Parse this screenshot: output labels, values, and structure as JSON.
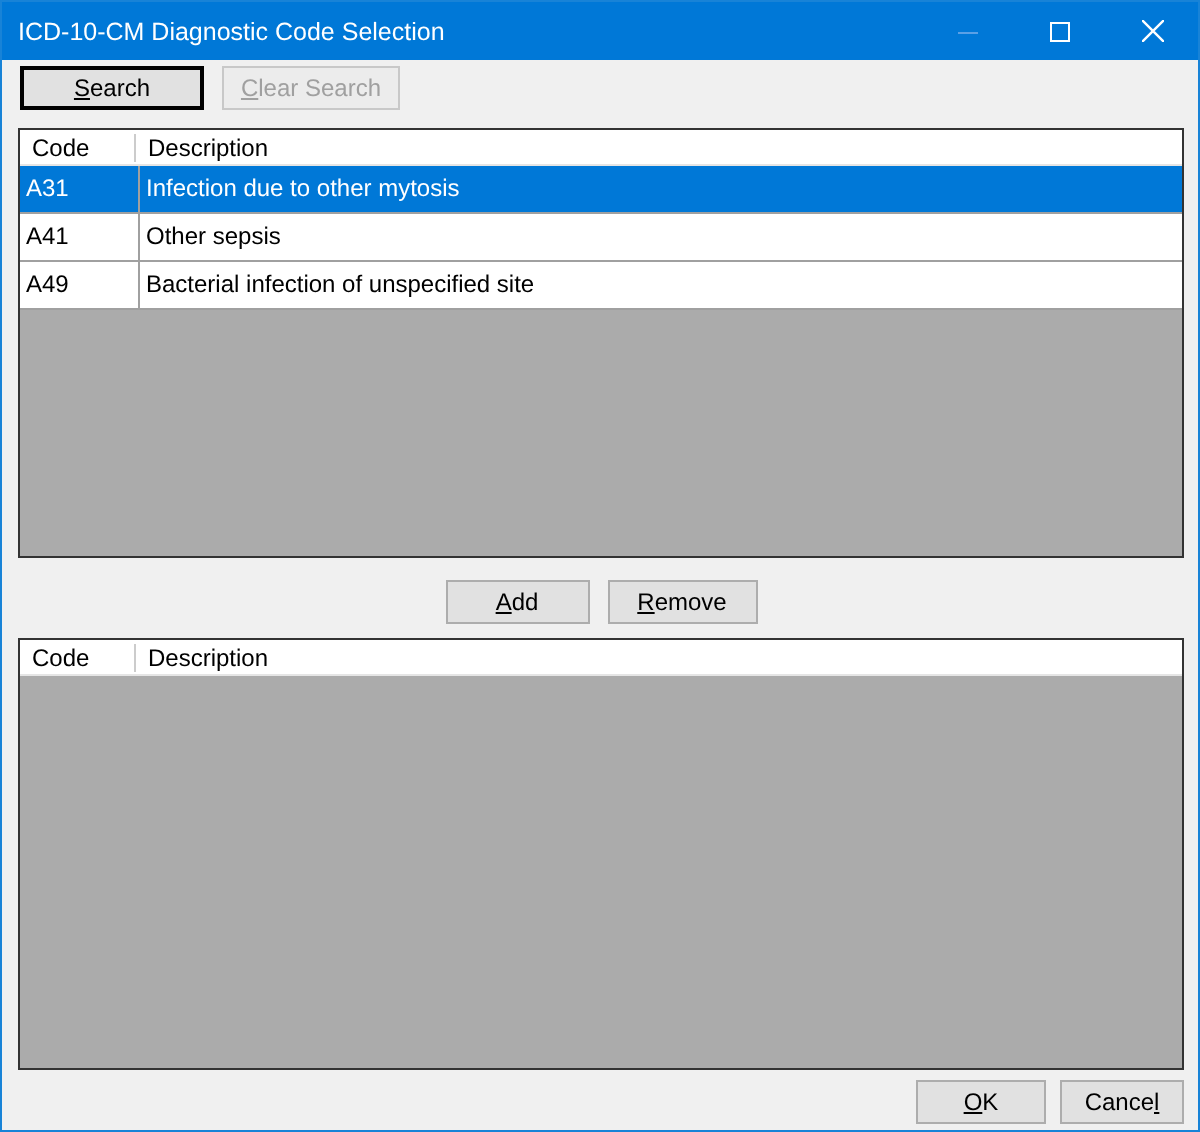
{
  "window": {
    "title": "ICD-10-CM Diagnostic Code Selection"
  },
  "search_buttons": [
    {
      "access_key": "S",
      "after": "earch",
      "disabled": false,
      "default": true
    },
    {
      "access_key": "C",
      "after": "lear Search",
      "disabled": true,
      "default": false
    }
  ],
  "available_codes": {
    "columns": [
      "Code",
      "Description"
    ],
    "rows": [
      {
        "cells": [
          "A31",
          "Infection due to other mytosis"
        ],
        "selected": true
      },
      {
        "cells": [
          "A41",
          "Other sepsis"
        ],
        "selected": false
      },
      {
        "cells": [
          "A49",
          "Bacterial infection of unspecified site"
        ],
        "selected": false
      }
    ]
  },
  "move_buttons": [
    {
      "access_key": "A",
      "after": "dd",
      "disabled": false,
      "default": false
    },
    {
      "access_key": "R",
      "after": "emove",
      "disabled": false,
      "default": false
    }
  ],
  "selected_codes": {
    "columns": [
      "Code",
      "Description"
    ]
  },
  "dialog_buttons": [
    {
      "access_key": "O",
      "after": "K",
      "disabled": false,
      "default": false
    },
    {
      "before": "Cance",
      "access_key": "l",
      "disabled": false,
      "default": false
    }
  ]
}
